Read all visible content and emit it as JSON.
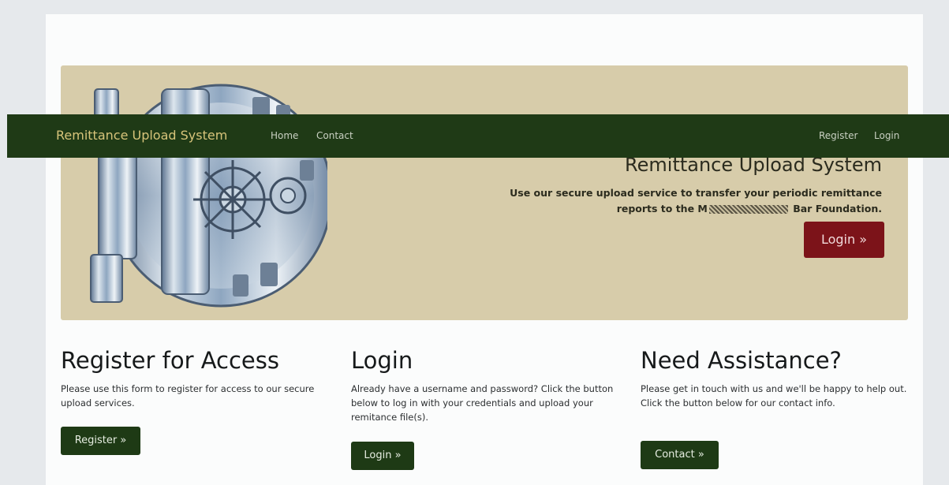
{
  "navbar": {
    "brand": "Remittance Upload System",
    "links": [
      "Home",
      "Contact"
    ],
    "right_links": [
      "Register",
      "Login"
    ]
  },
  "hero": {
    "title": "Remittance Upload System",
    "line1": "Use our secure upload service to transfer your periodic remittance",
    "line2_before": "reports to the M",
    "line2_after": " Bar Foundation.",
    "button": "Login »"
  },
  "columns": [
    {
      "title": "Register for Access",
      "text": "Please use this form to register for access to our secure upload services.",
      "button": "Register »"
    },
    {
      "title": "Login",
      "text": "Already have a username and password? Click the button below to log in with your credentials and upload your remitance file(s).",
      "button": "Login »"
    },
    {
      "title": "Need Assistance?",
      "text": "Please get in touch with us and we'll be happy to help out. Click the button below for our contact info.",
      "button": "Contact »"
    }
  ],
  "colors": {
    "navbar": "#1f3a16",
    "brand": "#d7c47a",
    "hero_bg": "#d7ccaa",
    "hero_button": "#7c1319",
    "primary_button": "#1e3a15"
  },
  "icons": {
    "hero_image": "vault-door-image"
  }
}
